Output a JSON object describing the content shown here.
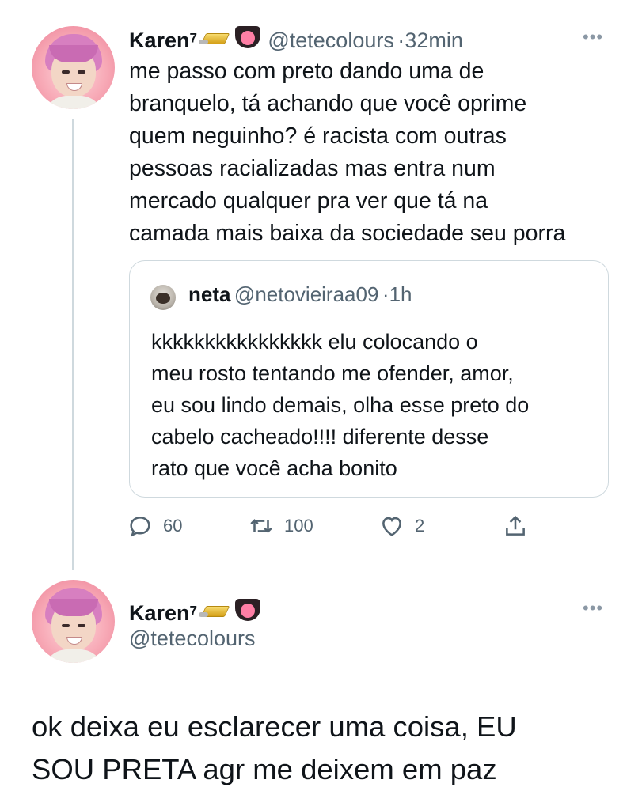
{
  "tweet1": {
    "author_name": "Karen",
    "author_sup": "7",
    "handle": "@tetecolours",
    "separator": "·",
    "time": "32min",
    "lines": [
      "me passo com preto dando uma de",
      "branquelo, tá achando que você oprime",
      "quem neguinho? é racista com outras",
      "pessoas racializadas mas entra num",
      "mercado qualquer pra ver que tá na",
      "camada mais baixa da sociedade seu porra"
    ]
  },
  "quoted": {
    "author_name": "neta",
    "handle": "@netovieiraa09",
    "separator": "·",
    "time": "1h",
    "lines": [
      "kkkkkkkkkkkkkkkk elu colocando o",
      "meu rosto tentando me ofender, amor,",
      "eu sou lindo demais, olha esse preto do",
      "cabelo cacheado!!!! diferente desse",
      "rato que você acha bonito"
    ]
  },
  "actions": {
    "reply_count": "60",
    "retweet_count": "100",
    "like_count": "2"
  },
  "tweet2": {
    "author_name": "Karen",
    "author_sup": "7",
    "handle": "@tetecolours",
    "lines": [
      "ok deixa eu esclarecer uma coisa, EU",
      "SOU PRETA agr me deixem em paz"
    ]
  },
  "icons": {
    "reply": "reply-icon",
    "retweet": "retweet-icon",
    "like": "heart-icon",
    "share": "share-icon",
    "more": "more-icon",
    "emoji_gold": "gold-bar-emoji",
    "emoji_tongue": "tongue-emoji"
  },
  "colors": {
    "text": "#0f1419",
    "secondary": "#536471",
    "border": "#cfd9de"
  }
}
